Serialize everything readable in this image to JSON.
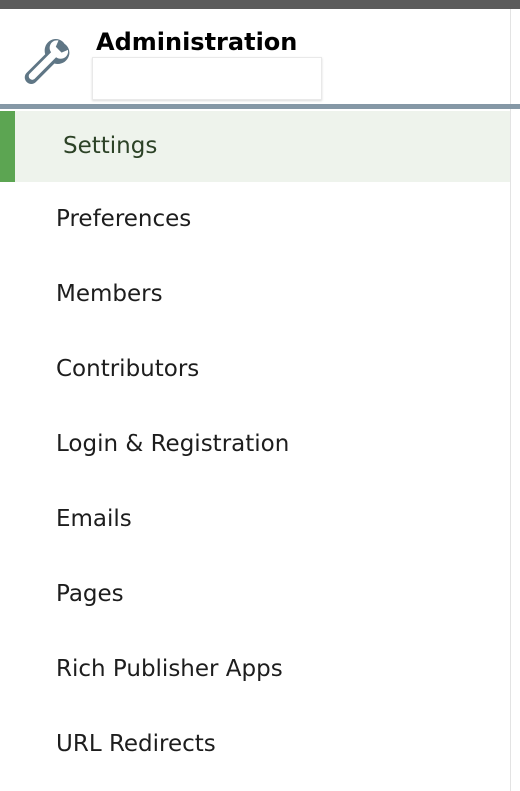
{
  "header": {
    "title": "Administration",
    "icon": "wrench-icon",
    "accent_color": "#5ca552",
    "divider_color": "#8598a6"
  },
  "sidebar": {
    "active_index": 0,
    "items": [
      {
        "label": "Settings"
      },
      {
        "label": "Preferences"
      },
      {
        "label": "Members"
      },
      {
        "label": "Contributors"
      },
      {
        "label": "Login & Registration"
      },
      {
        "label": "Emails"
      },
      {
        "label": "Pages"
      },
      {
        "label": "Rich Publisher Apps"
      },
      {
        "label": "URL Redirects"
      }
    ]
  }
}
